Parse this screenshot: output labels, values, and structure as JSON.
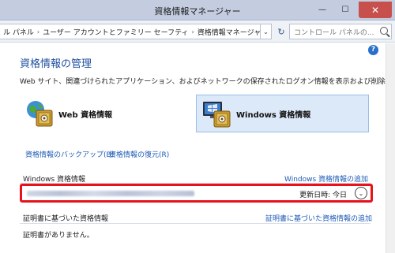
{
  "window": {
    "title": "資格情報マネージャー",
    "minimize_glyph": "—",
    "maximize_glyph": "☐",
    "close_glyph": "✕"
  },
  "address_bar": {
    "segments": [
      "ル パネル",
      "ユーザー アカウントとファミリー セーフティ",
      "資格情報マネージャー"
    ],
    "separator": "›",
    "dropdown_glyph": "⌄",
    "refresh_glyph": "↻"
  },
  "search": {
    "placeholder": "コントロール パネルの..."
  },
  "help_glyph": "?",
  "main": {
    "heading": "資格情報の管理",
    "description": "Web サイト、関連づけられたアプリケーション、およびネットワークの保存されたログオン情報を表示および削除します。"
  },
  "tiles": {
    "web_label": "Web 資格情報",
    "windows_label": "Windows 資格情報"
  },
  "links": {
    "backup": "資格情報のバックアップ(B)",
    "restore": "資格情報の復元(R)",
    "add_windows": "Windows 資格情報の追加",
    "add_certificate": "証明書に基づいた資格情報の追加"
  },
  "sections": {
    "windows_credentials": "Windows 資格情報",
    "certificate_credentials": "証明書に基づいた資格情報",
    "no_certificates": "証明書がありません。"
  },
  "credential_item": {
    "modified_label": "更新日時: 今日",
    "expand_glyph": "⌄"
  },
  "colors": {
    "accent_blue": "#1c5ab6",
    "highlight_red": "#e8121b",
    "selected_tile": "#dce9f8"
  }
}
